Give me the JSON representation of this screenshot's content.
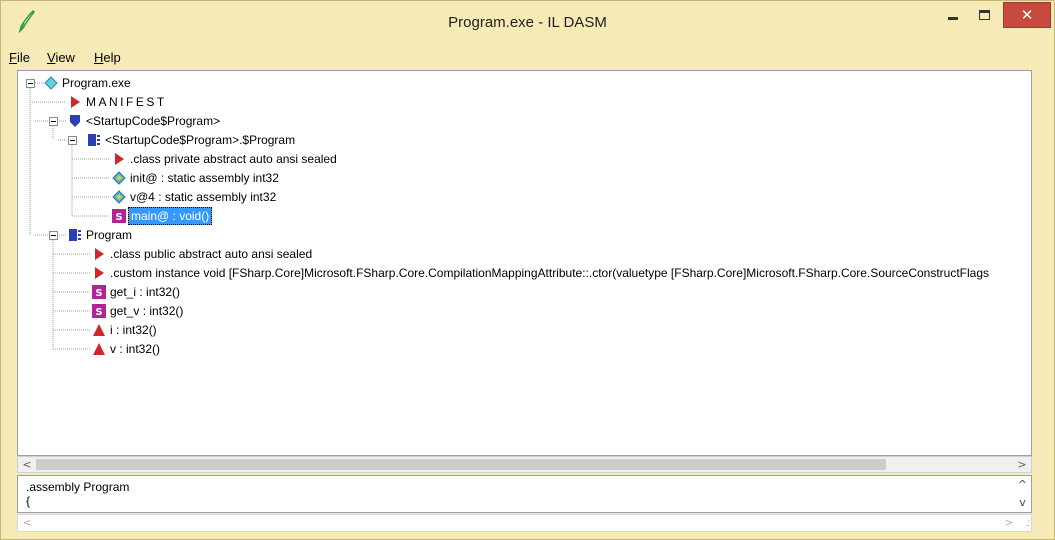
{
  "window": {
    "title": "Program.exe - IL DASM",
    "close_glyph": "✕"
  },
  "menu": {
    "items": [
      {
        "letter": "F",
        "rest": "ile"
      },
      {
        "letter": "V",
        "rest": "iew"
      },
      {
        "letter": "H",
        "rest": "elp"
      }
    ]
  },
  "tree": {
    "root": "Program.exe",
    "manifest": "MANIFEST",
    "startup_ns": "<StartupCode$Program>",
    "startup_class": "<StartupCode$Program>.$Program",
    "startup_class_decl": ".class private abstract auto ansi sealed",
    "field_init": "init@ : static assembly int32",
    "field_v": "v@4 : static assembly int32",
    "method_main": "main@ : void()",
    "program_class": "Program",
    "program_class_decl": ".class public abstract auto ansi sealed",
    "program_custom": ".custom instance void [FSharp.Core]Microsoft.FSharp.Core.CompilationMappingAttribute::.ctor(valuetype [FSharp.Core]Microsoft.FSharp.Core.SourceConstructFlags",
    "method_get_i": "get_i : int32()",
    "method_get_v": "get_v : int32()",
    "prop_i": "i : int32()",
    "prop_v": "v : int32()",
    "static_badge": "S"
  },
  "output": {
    "line1": ".assembly Program",
    "line2": "{"
  },
  "scroll": {
    "left": "<",
    "right": ">",
    "up": "^",
    "down": "v"
  },
  "icons": {
    "manifest": "red-triangle-icon",
    "namespace": "blue-shield-icon",
    "class": "blue-class-icon",
    "field": "cyan-diamond-icon",
    "method": "magenta-s-icon",
    "property": "red-up-triangle-icon"
  },
  "colors": {
    "frame": "#f6ebb6",
    "close": "#c7493f",
    "selection": "#3399ff",
    "red_icon": "#d0262a",
    "blue_icon": "#2b3fb5",
    "magenta_icon": "#b0249a"
  }
}
